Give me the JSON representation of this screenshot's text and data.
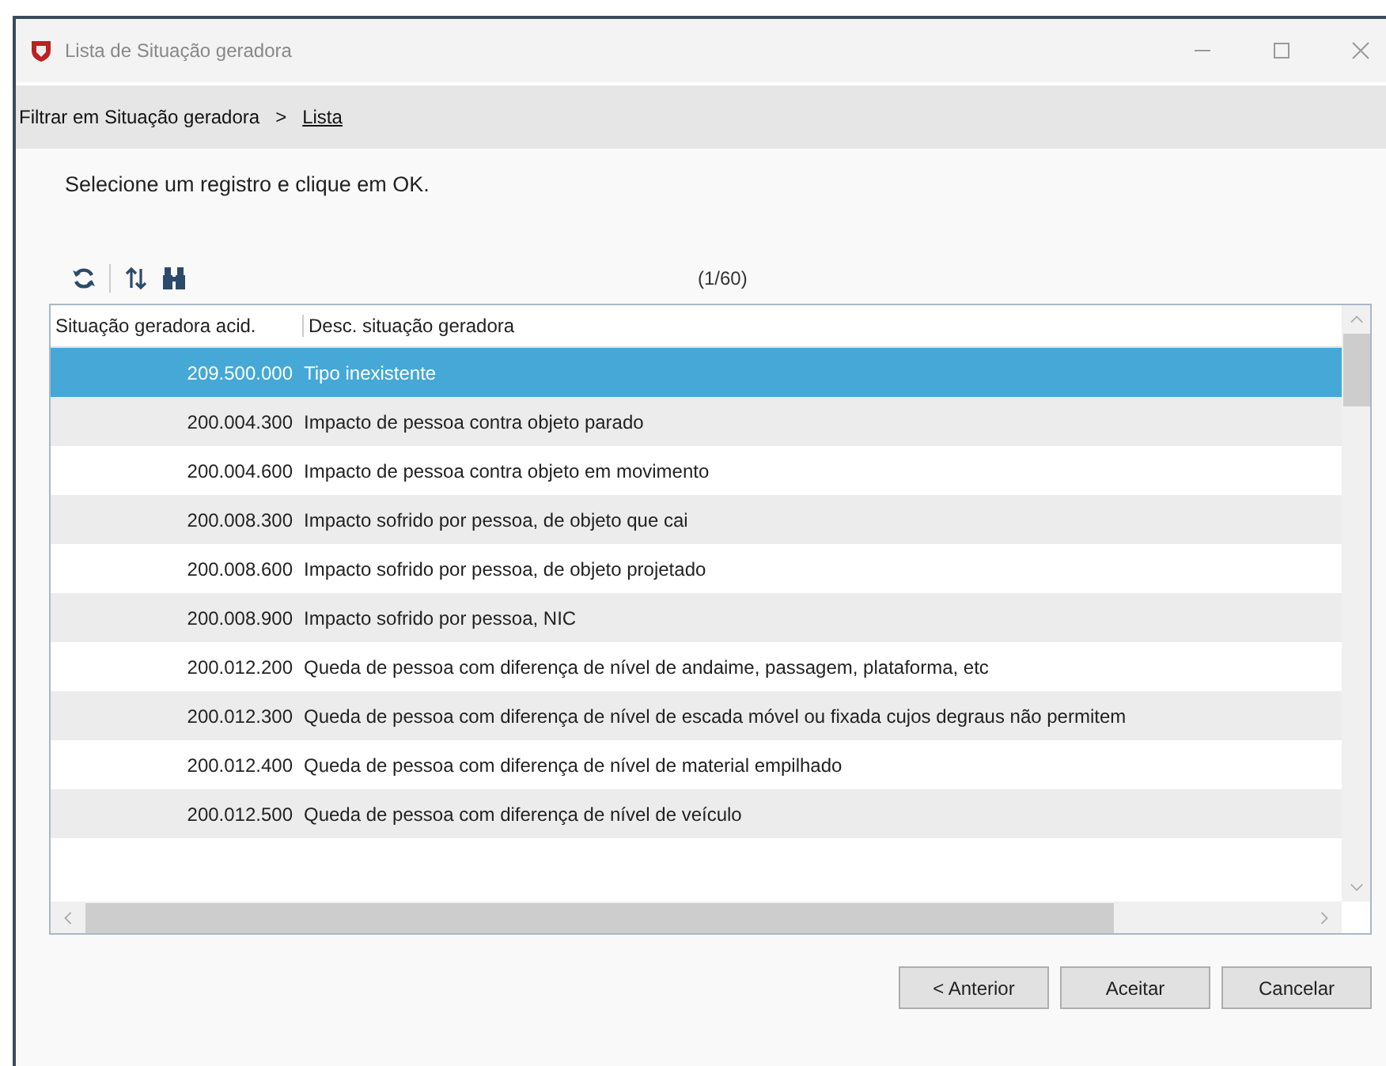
{
  "window": {
    "title": "Lista de Situação geradora"
  },
  "breadcrumb": [
    {
      "label": "Filtrar em Situação geradora",
      "current": false
    },
    {
      "label": "Lista",
      "current": true
    }
  ],
  "breadcrumb_separator": ">",
  "instruction": "Selecione um registro e clique em OK.",
  "record_count": "(1/60)",
  "table": {
    "columns": [
      "Situação geradora acid.",
      "Desc. situação geradora"
    ],
    "rows": [
      {
        "code": "209.500.000",
        "description": "Tipo inexistente",
        "selected": true
      },
      {
        "code": "200.004.300",
        "description": "Impacto de pessoa contra objeto parado",
        "selected": false
      },
      {
        "code": "200.004.600",
        "description": "Impacto de pessoa contra objeto em movimento",
        "selected": false
      },
      {
        "code": "200.008.300",
        "description": "Impacto sofrido por pessoa, de objeto que cai",
        "selected": false
      },
      {
        "code": "200.008.600",
        "description": "Impacto sofrido por pessoa, de objeto projetado",
        "selected": false
      },
      {
        "code": "200.008.900",
        "description": "Impacto sofrido por pessoa, NIC",
        "selected": false
      },
      {
        "code": "200.012.200",
        "description": "Queda de pessoa com diferença de nível de andaime, passagem, plataforma, etc",
        "selected": false
      },
      {
        "code": "200.012.300",
        "description": "Queda de pessoa com diferença de nível de escada móvel ou fixada cujos degraus não permitem",
        "selected": false
      },
      {
        "code": "200.012.400",
        "description": "Queda de pessoa com diferença de nível de material empilhado",
        "selected": false
      },
      {
        "code": "200.012.500",
        "description": "Queda de pessoa com diferença de nível de veículo",
        "selected": false
      }
    ]
  },
  "buttons": [
    "< Anterior",
    "Aceitar",
    "Cancelar"
  ]
}
